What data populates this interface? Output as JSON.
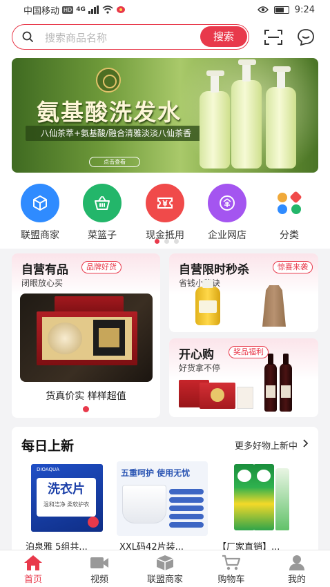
{
  "status_bar": {
    "carrier": "中国移动",
    "network": "4G",
    "hd": "HD",
    "time": "9:24"
  },
  "search": {
    "placeholder": "搜索商品名称",
    "button_label": "搜索"
  },
  "banner": {
    "title": "氨基酸洗发水",
    "subtitle": "八仙茶萃+氨基酸/融合清雅淡淡八仙茶香",
    "cta": "点击查看"
  },
  "quick_menu": [
    {
      "label": "联盟商家",
      "icon": "cube-icon",
      "color": "#2f8bff"
    },
    {
      "label": "菜篮子",
      "icon": "basket-icon",
      "color": "#23b66a"
    },
    {
      "label": "现金抵用",
      "icon": "cash-ticket-icon",
      "color": "#f04a4a"
    },
    {
      "label": "企业网店",
      "icon": "enterprise-icon",
      "color": "#a455f0"
    },
    {
      "label": "分类",
      "icon": "category-icon",
      "color": "#f0a93a"
    }
  ],
  "promo": {
    "self_goods": {
      "title": "自营有品",
      "tag": "品牌好货",
      "subtitle": "闭眼放心买",
      "caption": "货真价实 样样超值"
    },
    "flash_sale": {
      "title": "自营限时秒杀",
      "tag": "惊喜来袭",
      "subtitle": "省钱小秘诀"
    },
    "happy_buy": {
      "title": "开心购",
      "tag": "奖品福利",
      "subtitle": "好货拿不停"
    }
  },
  "daily_new": {
    "title": "每日上新",
    "more_label": "更多好物上新中",
    "products": [
      {
        "name": "泊泉雅 5组共...",
        "brand": "DIOAQUA",
        "pack_title": "洗衣片",
        "pack_sub": "温和洁净 柔软护衣"
      },
      {
        "name": "XXL码42片装...",
        "pack_title": "五重呵护 使用无忧"
      },
      {
        "name": "【厂家直销】..."
      }
    ]
  },
  "tab_bar": [
    {
      "label": "首页",
      "icon": "home-icon",
      "active": true
    },
    {
      "label": "视频",
      "icon": "video-icon",
      "active": false
    },
    {
      "label": "联盟商家",
      "icon": "box-icon",
      "active": false
    },
    {
      "label": "购物车",
      "icon": "cart-icon",
      "active": false
    },
    {
      "label": "我的",
      "icon": "user-icon",
      "active": false
    }
  ],
  "colors": {
    "accent": "#e8394b",
    "page_bg": "#f3f3f5"
  }
}
